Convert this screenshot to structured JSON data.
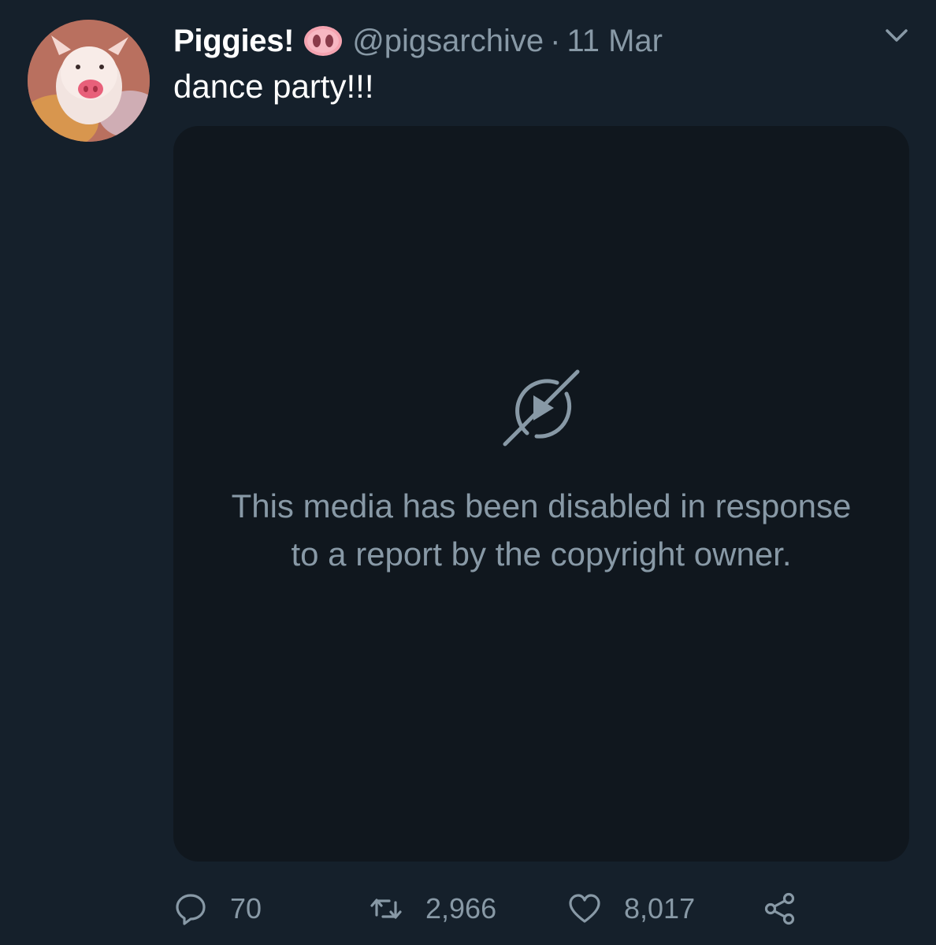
{
  "tweet": {
    "display_name": "Piggies!",
    "name_emoji": "pig-nose-emoji",
    "handle": "@pigsarchive",
    "separator": "·",
    "timestamp": "11 Mar",
    "text": "dance party!!!",
    "avatar_alt": "pig-photo-avatar"
  },
  "media": {
    "icon": "media-disabled-icon",
    "message": "This media has been disabled in response to a report by the copyright owner."
  },
  "actions": {
    "reply_count": "70",
    "retweet_count": "2,966",
    "like_count": "8,017",
    "reply_icon": "reply-icon",
    "retweet_icon": "retweet-icon",
    "like_icon": "heart-icon",
    "share_icon": "share-icon"
  },
  "colors": {
    "background": "#15202b",
    "media_background": "#10171e",
    "primary_text": "#ffffff",
    "secondary_text": "#8899a6"
  }
}
